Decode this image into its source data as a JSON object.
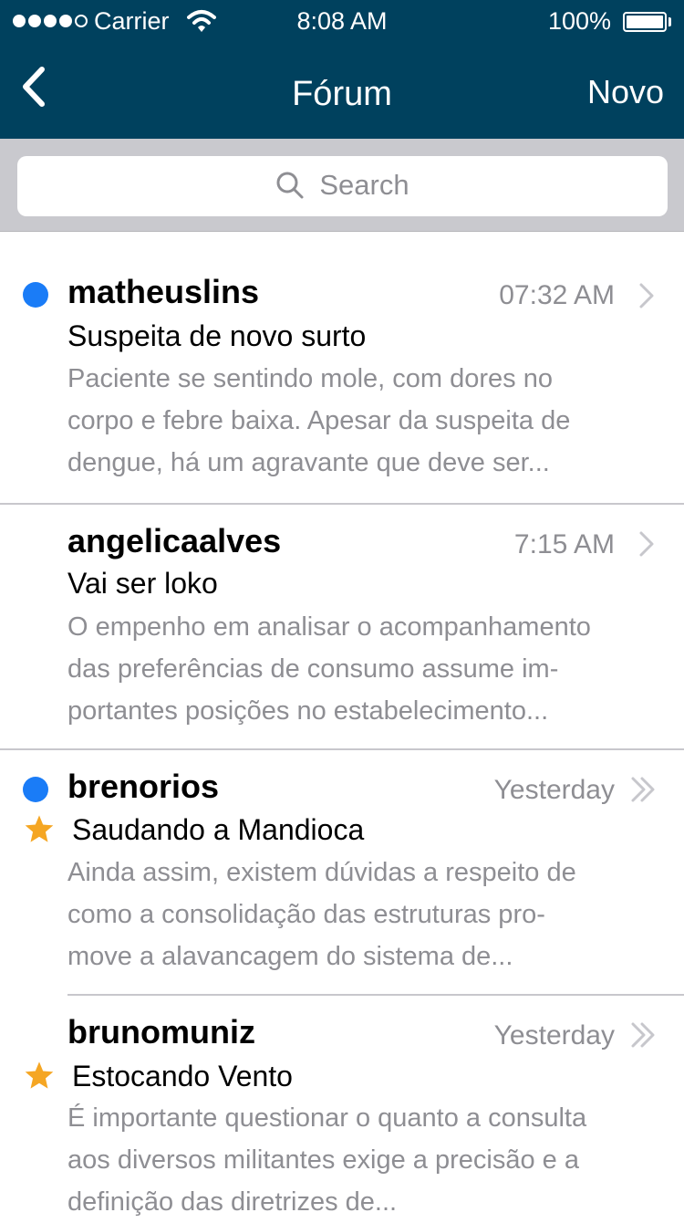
{
  "status_bar": {
    "carrier": "Carrier",
    "time": "8:08 AM",
    "battery": "100%"
  },
  "nav": {
    "back_icon": "chevron-left-icon",
    "title": "Fórum",
    "action": "Novo"
  },
  "search": {
    "placeholder": "Search"
  },
  "colors": {
    "nav_bg": "#00415e",
    "unread_dot": "#1a7cf7",
    "star": "#f5a623",
    "secondary_text": "#8e8e93"
  },
  "messages": [
    {
      "sender": "matheuslins",
      "time": "07:32 AM",
      "subject": "Suspeita de novo surto",
      "preview": [
        "Paciente se sentindo mole, com dores no",
        "corpo e febre baixa. Apesar da suspeita de",
        "dengue, há um agravante que deve ser..."
      ],
      "unread": true,
      "starred": false,
      "chevron": "chevron-right-icon"
    },
    {
      "sender": "angelicaalves",
      "time": "7:15 AM",
      "subject": "Vai ser loko",
      "preview": [
        "O empenho em analisar o acompanhamento",
        "das preferências de consumo assume im-",
        "portantes posições no estabelecimento..."
      ],
      "unread": false,
      "starred": false,
      "chevron": "chevron-right-icon"
    },
    {
      "sender": "brenorios",
      "time": "Yesterday",
      "subject": "Saudando a Mandioca",
      "preview": [
        "Ainda assim, existem dúvidas a respeito de",
        "como a consolidação das estruturas pro-",
        "move a alavancagem do sistema de..."
      ],
      "unread": true,
      "starred": true,
      "chevron": "double-chevron-right-icon"
    },
    {
      "sender": "brunomuniz",
      "time": "Yesterday",
      "subject": "Estocando Vento",
      "preview": [
        "É importante questionar o quanto a consulta",
        "aos diversos militantes exige a precisão e a",
        "definição das diretrizes de..."
      ],
      "unread": false,
      "starred": true,
      "chevron": "double-chevron-right-icon"
    }
  ]
}
